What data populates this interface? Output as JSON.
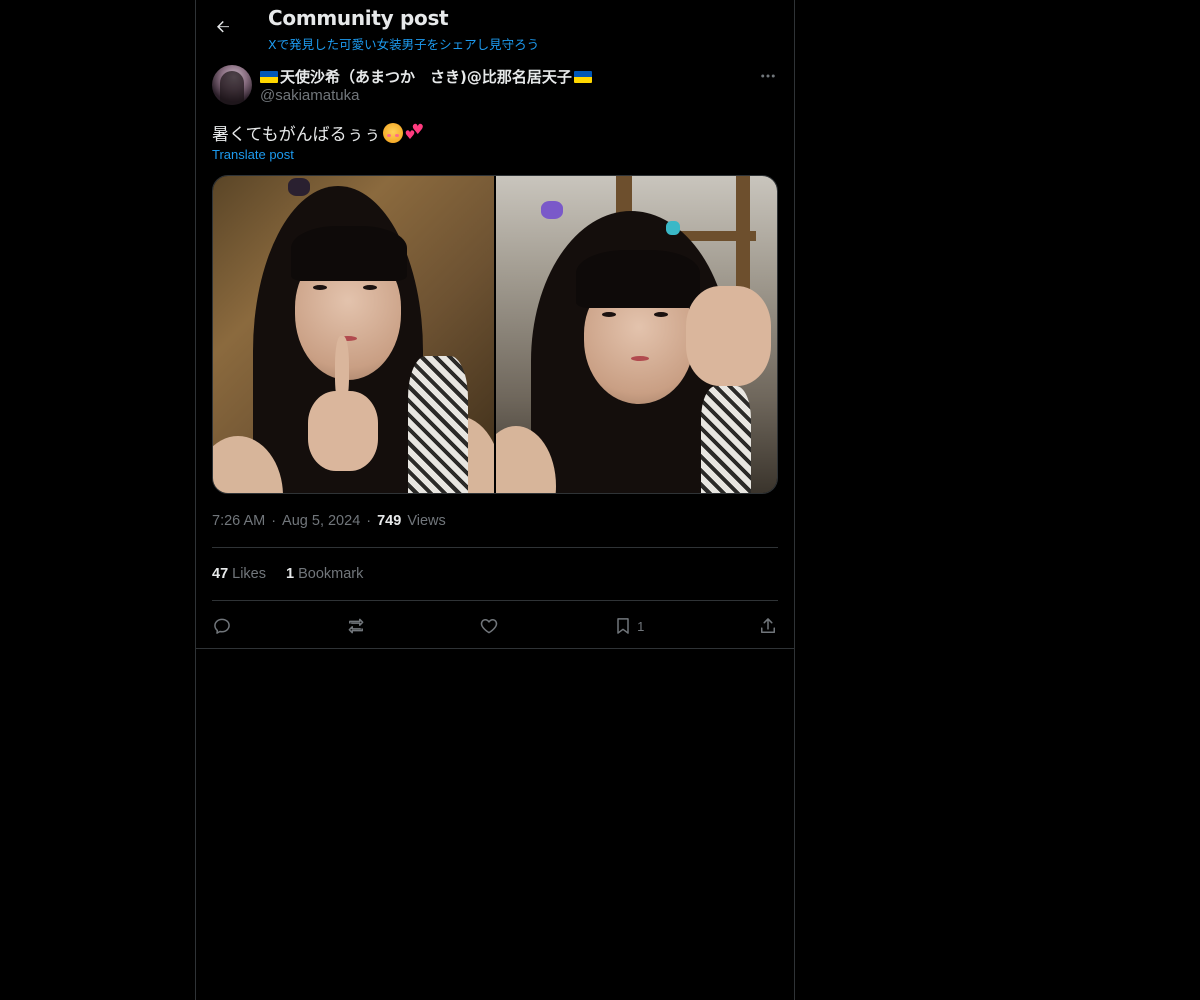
{
  "header": {
    "title": "Community post",
    "subtitle": "Xで発見した可愛い女装男子をシェアし見守ろう"
  },
  "author": {
    "name": "天使沙希（あまつか　さき)@比那名居天子",
    "handle": "@sakiamatuka"
  },
  "post": {
    "text": "暑くてもがんばるぅぅ",
    "translate_label": "Translate post",
    "time": "7:26 AM",
    "date": "Aug 5, 2024",
    "views_count": "749",
    "views_label": "Views"
  },
  "stats": {
    "likes_count": "47",
    "likes_label": "Likes",
    "bookmarks_count": "1",
    "bookmarks_label": "Bookmark"
  },
  "actions": {
    "bookmark_count": "1"
  },
  "icons": {
    "back": "arrow-left-icon",
    "more": "more-horizontal-icon",
    "reply": "reply-icon",
    "repost": "repost-icon",
    "like": "heart-icon",
    "bookmark": "bookmark-icon",
    "share": "share-icon"
  },
  "colors": {
    "background": "#000000",
    "text_primary": "#e7e9ea",
    "text_secondary": "#71767b",
    "accent": "#1d9bf0",
    "border": "#2f3336",
    "flag_blue": "#0057b7",
    "flag_yellow": "#ffd700"
  }
}
